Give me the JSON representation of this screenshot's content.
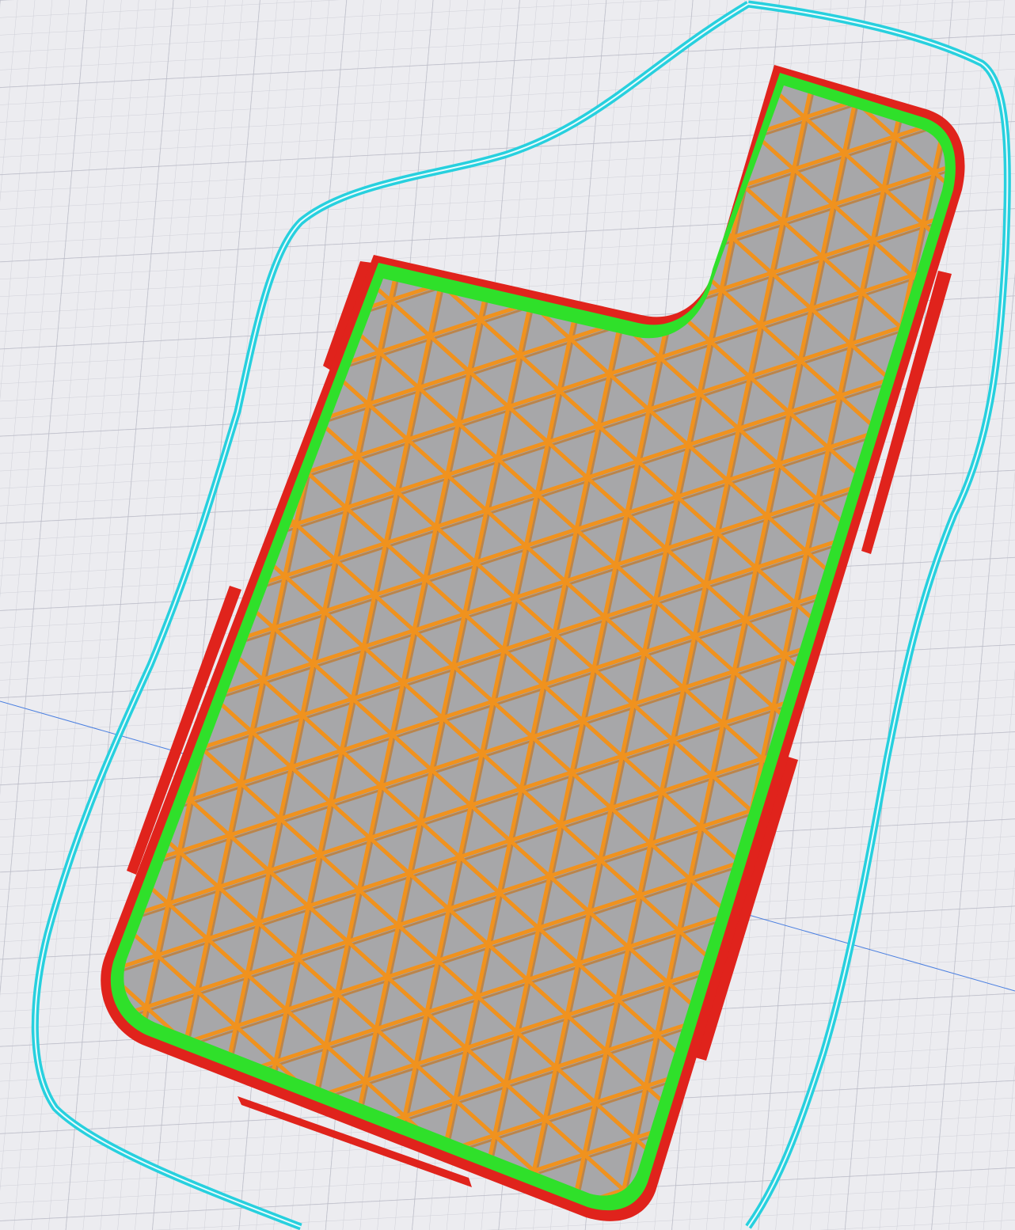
{
  "viewport": {
    "colors": {
      "background": "#ececf0",
      "grid_minor": "#cfd0d8",
      "grid_major": "#b9bac6",
      "axis_line": "#4a7fe0",
      "skirt": "#27d0de",
      "outer_wall": "#e0231c",
      "inner_wall": "#2fe02a",
      "infill": "#f0921e",
      "fill_floor": "#a7a7a9"
    }
  }
}
